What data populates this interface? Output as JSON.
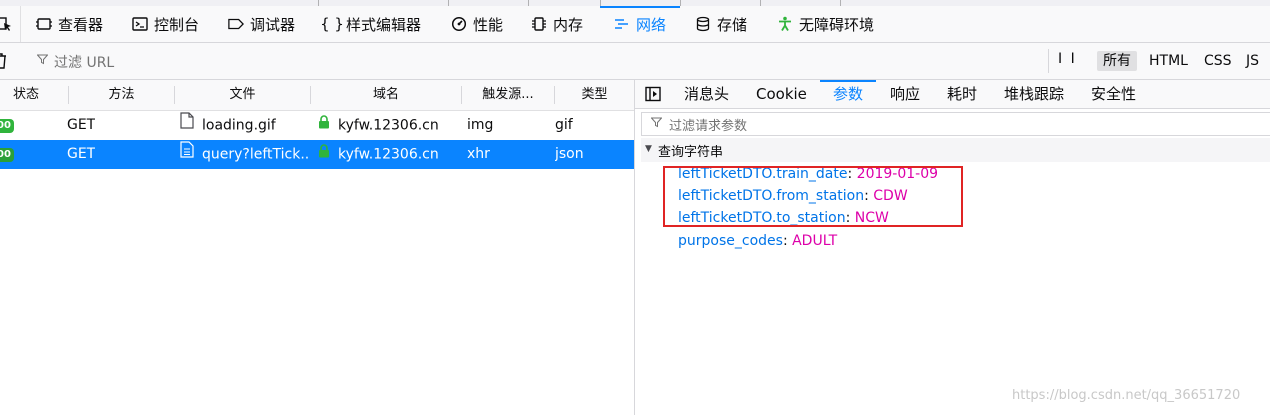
{
  "toolbar": {
    "tools": [
      {
        "label": "查看器",
        "icon": "inspector-icon"
      },
      {
        "label": "控制台",
        "icon": "console-icon"
      },
      {
        "label": "调试器",
        "icon": "debugger-icon"
      },
      {
        "label": "样式编辑器",
        "icon": "style-editor-icon"
      },
      {
        "label": "性能",
        "icon": "performance-icon"
      },
      {
        "label": "内存",
        "icon": "memory-icon"
      },
      {
        "label": "网络",
        "icon": "network-icon",
        "active": true
      },
      {
        "label": "存储",
        "icon": "storage-icon"
      },
      {
        "label": "无障碍环境",
        "icon": "accessibility-icon"
      }
    ]
  },
  "filterbar": {
    "placeholder": "过滤 URL",
    "pause": "I I",
    "types": [
      "所有",
      "HTML",
      "CSS",
      "JS"
    ],
    "active_type": "所有"
  },
  "requests": {
    "columns": [
      "状态",
      "方法",
      "文件",
      "域名",
      "触发源...",
      "类型"
    ],
    "rows": [
      {
        "status": "00",
        "method": "GET",
        "file": "loading.gif",
        "domain": "kyfw.12306.cn",
        "cause": "img",
        "type": "gif",
        "selected": false
      },
      {
        "status": "00",
        "method": "GET",
        "file": "query?leftTick...",
        "domain": "kyfw.12306.cn",
        "cause": "xhr",
        "type": "json",
        "selected": true
      }
    ]
  },
  "details": {
    "tabs": [
      "消息头",
      "Cookie",
      "参数",
      "响应",
      "耗时",
      "堆栈跟踪",
      "安全性"
    ],
    "active_tab": "参数",
    "filter_placeholder": "过滤请求参数",
    "group_label": "查询字符串",
    "params": [
      {
        "key": "leftTicketDTO.train_date",
        "value": "2019-01-09"
      },
      {
        "key": "leftTicketDTO.from_station",
        "value": "CDW"
      },
      {
        "key": "leftTicketDTO.to_station",
        "value": "NCW"
      },
      {
        "key": "purpose_codes",
        "value": "ADULT"
      }
    ]
  },
  "colors": {
    "accent": "#0a84ff",
    "param_key": "#0074e8",
    "param_value": "#dd00a9",
    "status_ok": "#30b43c",
    "highlight_box": "#e02424"
  },
  "watermark": "https://blog.csdn.net/qq_36651720"
}
